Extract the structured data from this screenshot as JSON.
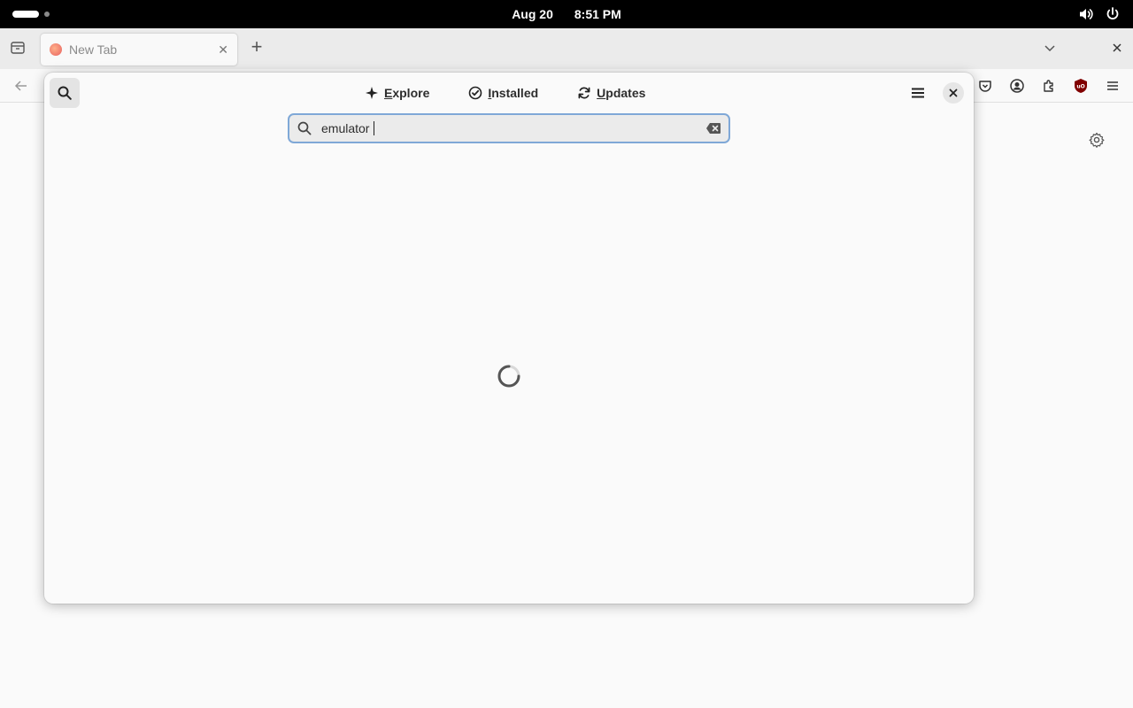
{
  "topbar": {
    "date": "Aug 20",
    "time": "8:51 PM",
    "icons": [
      "workspace-indicator-icon",
      "volume-icon",
      "power-icon"
    ]
  },
  "browser": {
    "tab": {
      "title": "New Tab"
    },
    "icons": [
      "tab-list-icon",
      "new-tab-icon",
      "all-tabs-chevron-icon",
      "window-close-icon",
      "back-icon",
      "pocket-icon",
      "account-icon",
      "extensions-icon",
      "ublock-icon",
      "hamburger-menu-icon",
      "settings-gear-icon"
    ]
  },
  "software": {
    "tabs": [
      {
        "label": "Explore",
        "mnemonic": "E",
        "rest": "xplore"
      },
      {
        "label": "Installed",
        "mnemonic": "I",
        "rest": "nstalled"
      },
      {
        "label": "Updates",
        "mnemonic": "U",
        "rest": "pdates"
      }
    ],
    "search": {
      "value": "emulator"
    },
    "status": "loading",
    "colors": {
      "focus_ring": "#7fa8d7",
      "ublock_red": "#800000"
    }
  }
}
